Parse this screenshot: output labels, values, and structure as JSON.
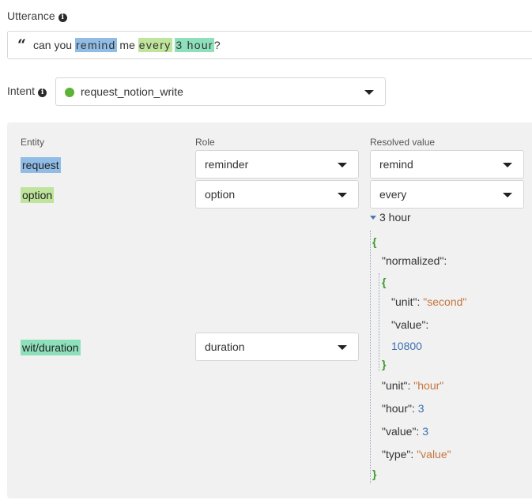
{
  "utterance": {
    "label": "Utterance",
    "text_parts": {
      "p1": "can you ",
      "remind": "remind",
      "p2": " me ",
      "every": "every",
      "p3": " ",
      "three_hour": "3 hour",
      "p4": "?"
    }
  },
  "intent": {
    "label": "Intent",
    "value": "request_notion_write",
    "status_color": "#5cb335"
  },
  "entities": {
    "headers": {
      "entity": "Entity",
      "role": "Role",
      "resolved": "Resolved value"
    },
    "rows": [
      {
        "entity": "request",
        "role": "reminder",
        "resolved": "remind",
        "color": "#90bce6"
      },
      {
        "entity": "option",
        "role": "option",
        "resolved": "every",
        "color": "#bfe49b"
      },
      {
        "entity": "wit/duration",
        "role": "duration",
        "color": "#8ee0bb"
      }
    ],
    "duration_value": {
      "summary": "3 hour",
      "lines": {
        "open": "{",
        "normalized_key": "\"normalized\"",
        "inner_open": "{",
        "unit_key": "\"unit\"",
        "unit_val": "\"second\"",
        "value_key": "\"value\"",
        "value_val": "10800",
        "inner_close": "}",
        "unit2_key": "\"unit\"",
        "unit2_val": "\"hour\"",
        "hour_key": "\"hour\"",
        "hour_val": "3",
        "value2_key": "\"value\"",
        "value2_val": "3",
        "type_key": "\"type\"",
        "type_val": "\"value\"",
        "close": "}"
      }
    }
  }
}
